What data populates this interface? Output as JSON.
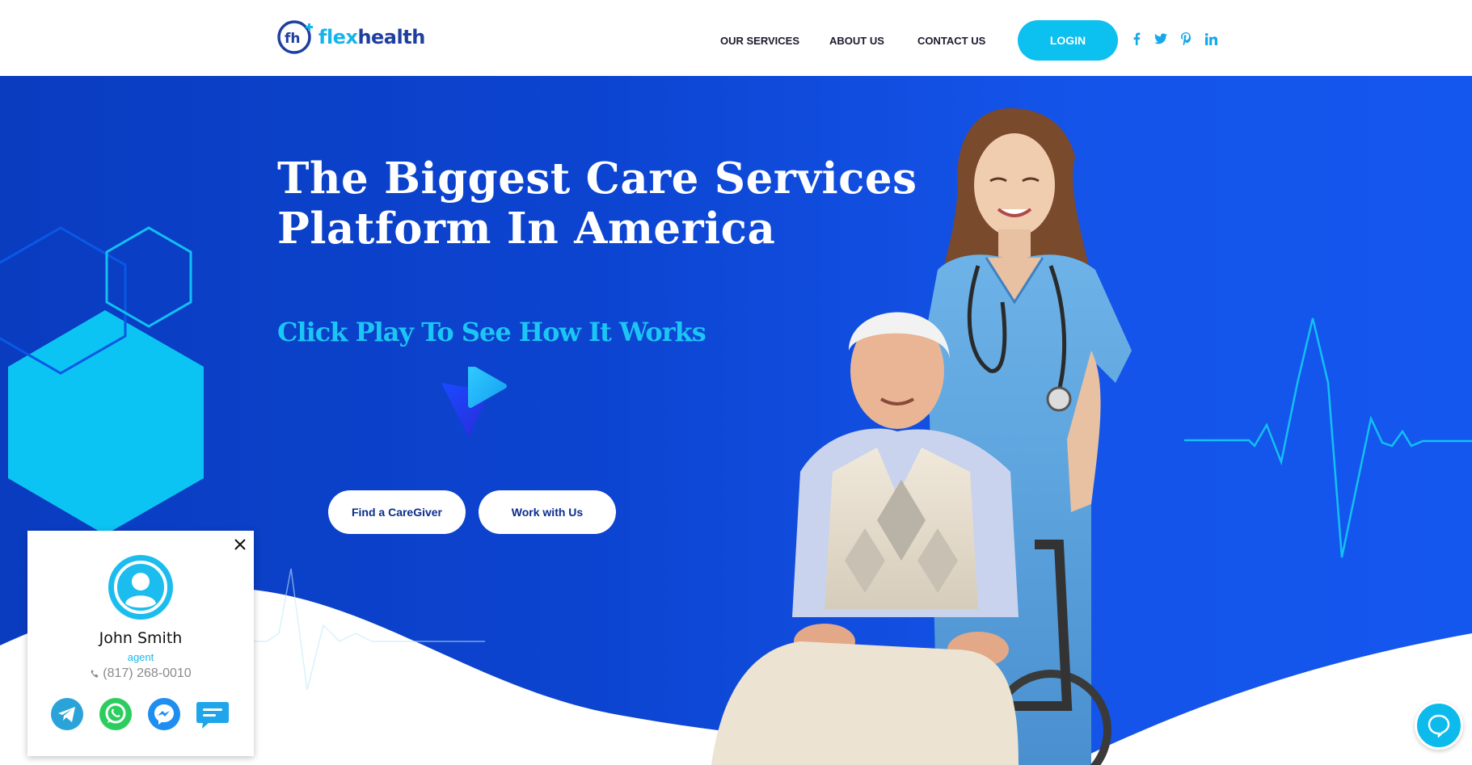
{
  "header": {
    "logo": {
      "part1": "flex",
      "part2": "health",
      "mark": "fh+"
    },
    "nav": [
      {
        "label": "OUR SERVICES"
      },
      {
        "label": "ABOUT US"
      },
      {
        "label": "CONTACT US"
      }
    ],
    "login_label": "LOGIN",
    "social": [
      "facebook-icon",
      "twitter-icon",
      "pinterest-icon",
      "linkedin-icon"
    ]
  },
  "hero": {
    "headline_line1": "The Biggest Care Services",
    "headline_line2": "Platform In America",
    "subhead": "Click Play To See How It Works",
    "find_button": "Find a CareGiver",
    "work_button": "Work with Us"
  },
  "contact_card": {
    "name": "John Smith",
    "role": "agent",
    "phone": "(817) 268-0010",
    "channels": [
      "telegram-icon",
      "whatsapp-icon",
      "messenger-icon",
      "sms-icon"
    ]
  },
  "colors": {
    "brand_blue": "#0c44d0",
    "accent_cyan": "#0cc0ef",
    "dark_text": "#1a1a2e"
  }
}
